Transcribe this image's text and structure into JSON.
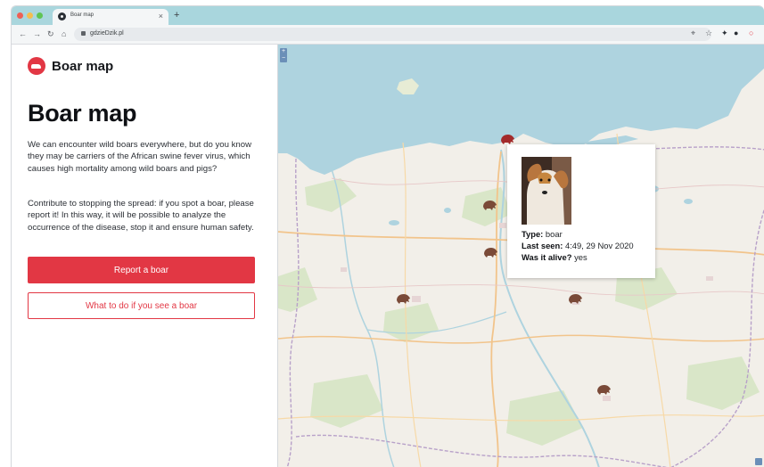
{
  "browser": {
    "tab_title": "Boar map",
    "tab_close": "×",
    "new_tab": "+",
    "url": "gdzieDzik.pl",
    "nav_icons": [
      "back-icon",
      "forward-icon",
      "reload-icon",
      "home-icon"
    ],
    "extension_icons": [
      "location-icon",
      "star-icon",
      "pin-icon",
      "mic-icon",
      "opera-icon"
    ],
    "traffic_lights": [
      "#ee5f55",
      "#f5bd4f",
      "#5fc454"
    ]
  },
  "sidebar": {
    "brand": "Boar map",
    "heading": "Boar map",
    "paragraph_1": "We can encounter wild boars everywhere, but do you know they may be carriers of the African swine fever virus, which causes high mortality among wild boars and pigs?",
    "paragraph_2": "Contribute to stopping the spread: if you spot a boar, please report it! In this way, it will be possible to analyze the occurrence of the disease, stop it and ensure human safety.",
    "primary_button": "Report a boar",
    "secondary_button": "What to do if you see a boar"
  },
  "map": {
    "zoom_in": "+",
    "zoom_out": "−",
    "popup": {
      "type_label": "Type:",
      "type_value": "boar",
      "last_seen_label": "Last seen:",
      "last_seen_value": "4:49, 29 Nov 2020",
      "alive_label": "Was it alive?",
      "alive_value": "yes"
    }
  },
  "colors": {
    "accent": "#e23744",
    "sea": "#aed3df",
    "land": "#f2efe9",
    "marker": "#7a4a38"
  }
}
